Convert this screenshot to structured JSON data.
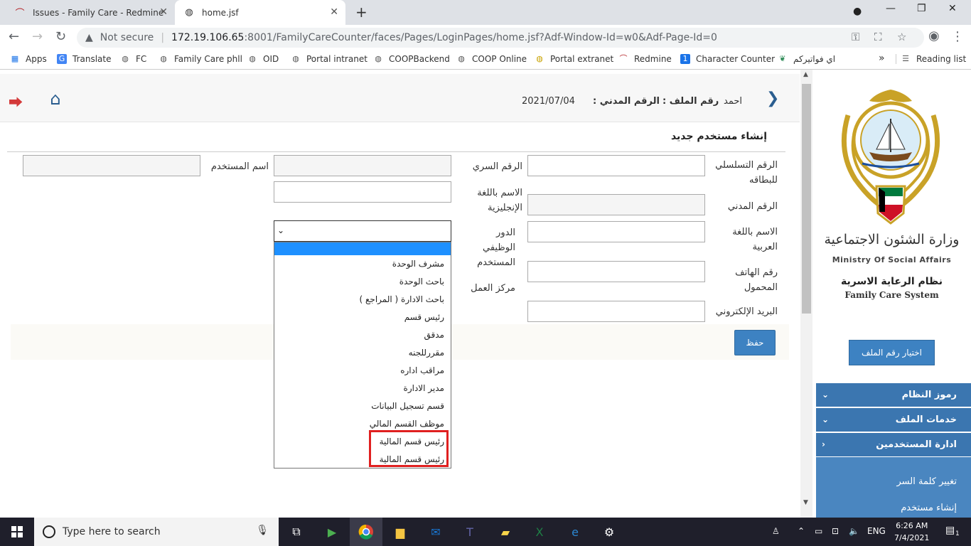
{
  "browser": {
    "tabs": [
      {
        "title": "Issues - Family Care - Redmine"
      },
      {
        "title": "home.jsf"
      }
    ],
    "security_label": "Not secure",
    "url_host": "172.19.106.65",
    "url_rest": ":8001/FamilyCareCounter/faces/Pages/LoginPages/home.jsf?Adf-Window-Id=w0&Adf-Page-Id=0",
    "bookmarks": [
      "Apps",
      "Translate",
      "FC",
      "Family Care phll",
      "OID",
      "Portal intranet",
      "COOPBackend",
      "COOP Online",
      "Portal extranet",
      "Redmine",
      "Character Counter",
      "اي فواتيركم"
    ],
    "bookmarks_overflow": "»",
    "reading_list": "Reading list"
  },
  "header": {
    "date": "2021/07/04",
    "civil_id_label": "الرقم المدني :",
    "file_no_label": "رقم الملف :",
    "user_name": "احمد"
  },
  "form": {
    "title": "إنشاء مستخدم جديد",
    "labels": {
      "serial": "الرقم التسلسلي للبطاقه",
      "password": "الرقم السري",
      "username": "اسم المستخدم",
      "civil_id": "الرقم المدني",
      "name_en": "الاسم باللغة الإنجليزية",
      "name_ar": "الاسم باللغة العربية",
      "role": "الدور الوظيفي المستخدم",
      "mobile": "رقم الهاتف المحمول",
      "work_center": "مركز العمل",
      "email": "البريد الإلكتروني"
    },
    "role_options": [
      "",
      "مشرف الوحدة",
      "باحث الوحدة",
      "باحث الادارة ( المراجع )",
      "رئيس قسم",
      "مدقق",
      "مقررللجنه",
      "مراقب اداره",
      "مدير الادارة",
      "قسم تسجيل البيانات",
      "موظف القسم المالي",
      "رئيس قسم المالية",
      "رئيس قسم المالية"
    ],
    "save_label": "حفظ"
  },
  "sidebar": {
    "ministry_ar": "وزارة الشئون الاجتماعية",
    "ministry_en": "Ministry Of Social Affairs",
    "system_ar": "نظام الرعاية الاسرية",
    "system_en": "Family Care System",
    "choose_file": "اختيار رقم الملف",
    "menus": [
      "رموز النظام",
      "خدمات الملف",
      "ادارة المستخدمين"
    ],
    "submenu": [
      "تغيير كلمة السر",
      "إنشاء مستخدم"
    ]
  },
  "taskbar": {
    "search_placeholder": "Type here to search",
    "lang": "ENG",
    "time": "6:26 AM",
    "date": "7/4/2021",
    "notifications": "1"
  },
  "colors": {
    "accent": "#3d82c2",
    "menu": "#3b76b0",
    "highlight": "#e02020",
    "selected_option": "#1e90ff"
  }
}
